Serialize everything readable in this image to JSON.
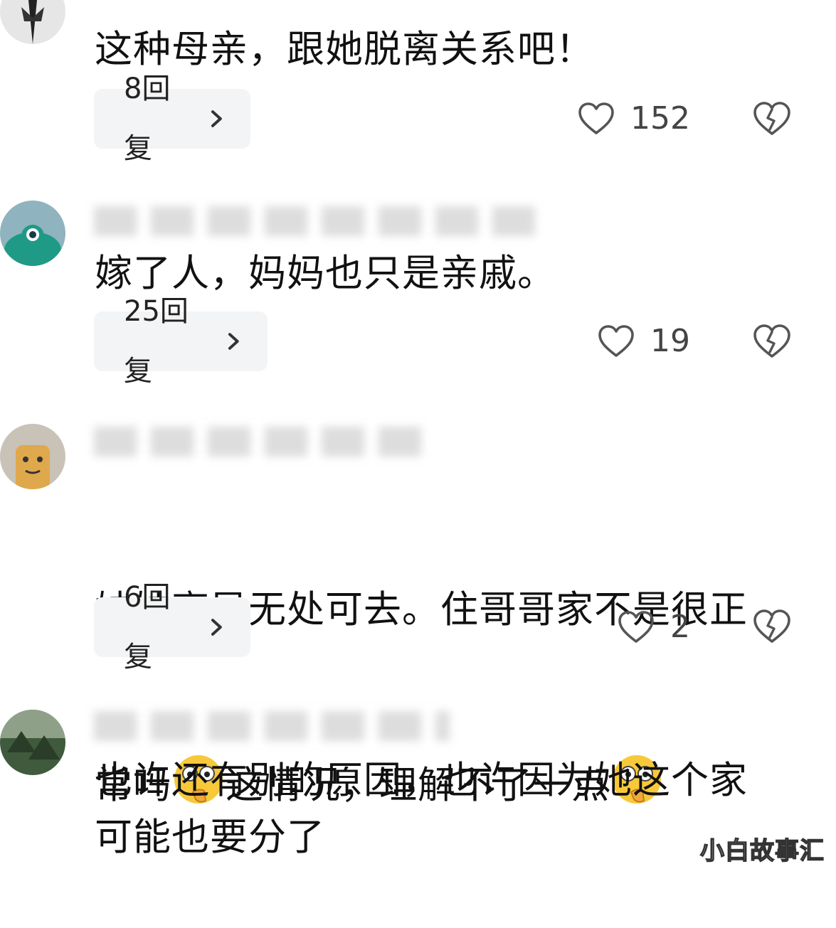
{
  "comments": [
    {
      "username": "",
      "text": "这种母亲，跟她脱离关系吧！",
      "replies": "8回复",
      "likes": "152"
    },
    {
      "username": "",
      "text": "嫁了人，妈妈也只是亲戚。",
      "replies": "25回复",
      "likes": "19"
    },
    {
      "username": "",
      "text_line1": "妹妹离异无处可去。住哥哥家不是很正",
      "text_line2a": "常吗",
      "text_line2b": "这情况，理解不了一点",
      "replies": "6回复",
      "likes": "2"
    },
    {
      "username": "",
      "text": "也许还有别的原因，也许因为她这个家\n可能也要分了"
    }
  ],
  "watermark": "小白故事汇",
  "icons": {
    "like": "heart-outline-icon",
    "dislike": "broken-heart-icon",
    "reply": "chevron-right-icon",
    "emoji": "thinking-eyes-emoji"
  },
  "colors": {
    "pill_bg": "#f3f4f5",
    "text": "#111111",
    "icon": "#555555"
  }
}
